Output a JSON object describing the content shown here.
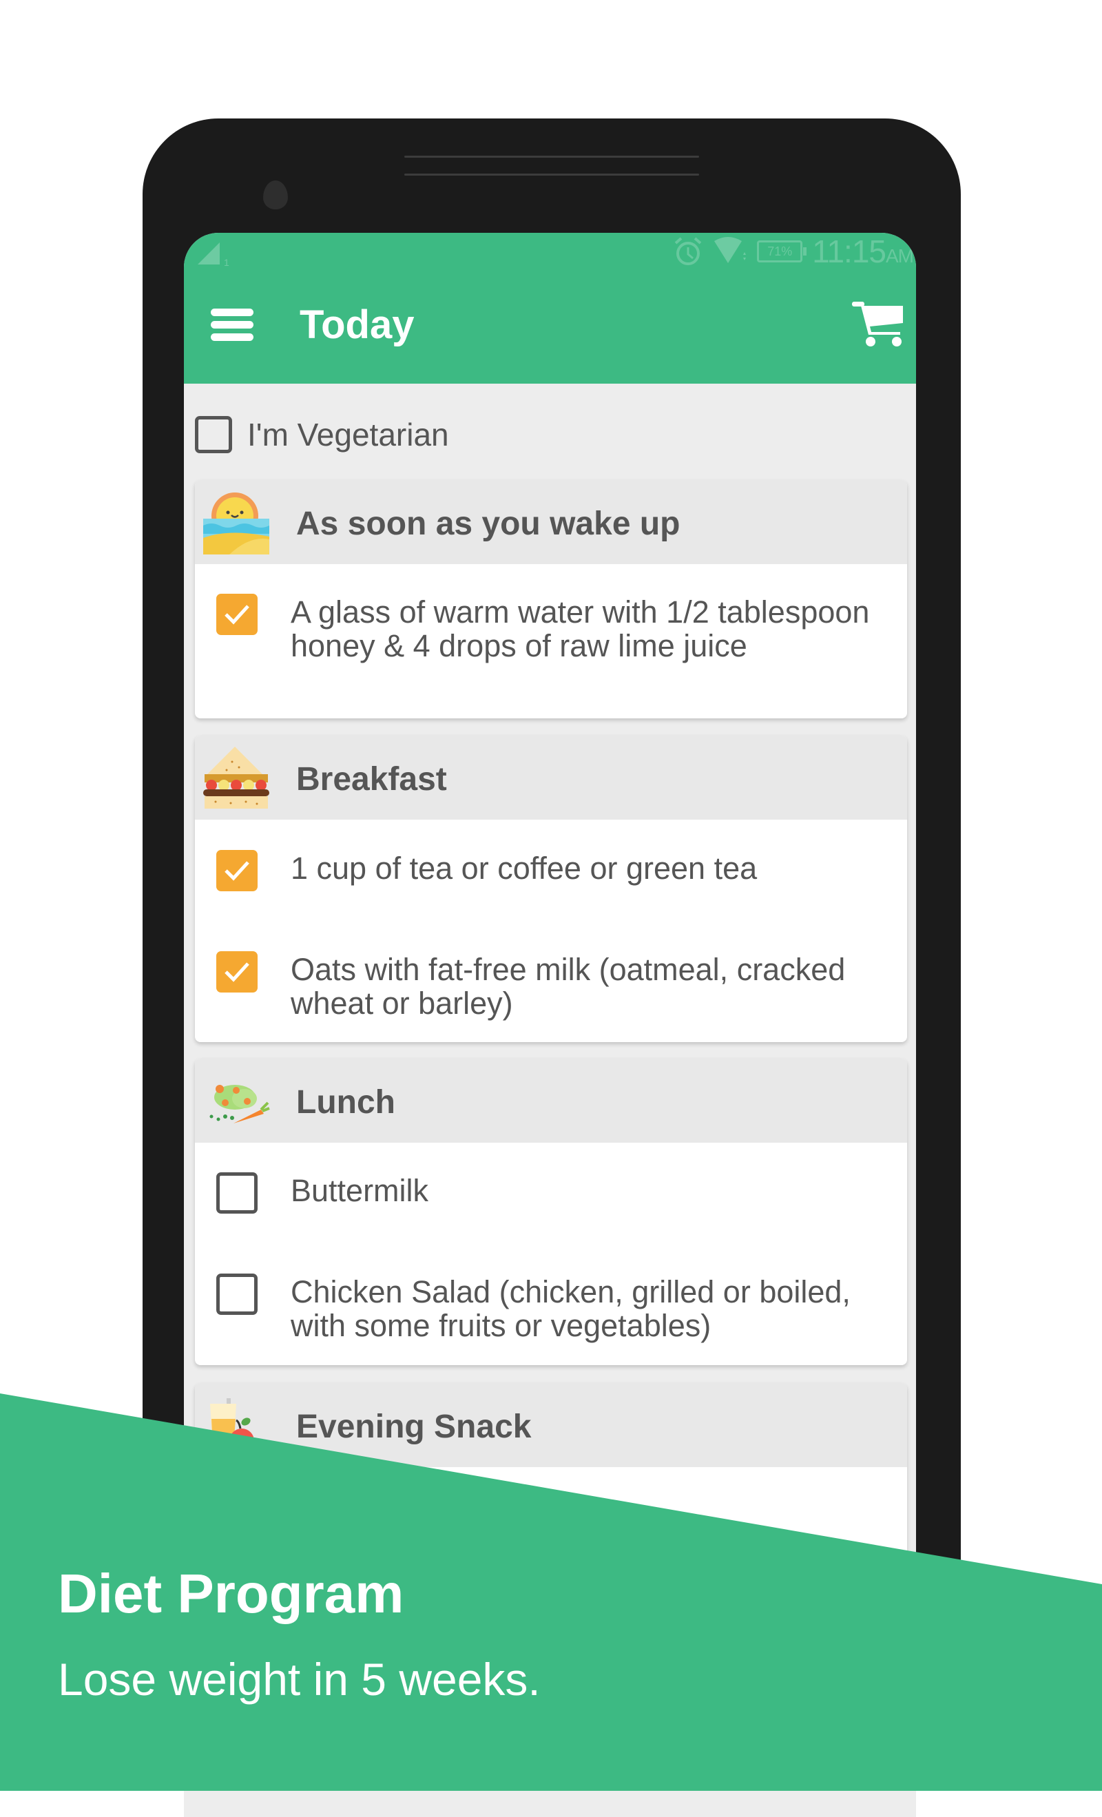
{
  "status_bar": {
    "signal_badge": "1",
    "battery": "71%",
    "time": "11:15",
    "ampm": "AM",
    "icons": [
      "signal-icon",
      "alarm-icon",
      "wifi-icon",
      "battery-icon"
    ]
  },
  "app_bar": {
    "title": "Today",
    "menu_icon": "hamburger-menu-icon",
    "cart_icon": "shopping-cart-icon"
  },
  "vegetarian": {
    "label": "I'm Vegetarian",
    "checked": false
  },
  "meals": [
    {
      "title": "As soon as you wake up",
      "icon": "sunrise-icon",
      "items": [
        {
          "text": "A glass of warm water with 1/2 tablespoon honey & 4 drops of raw lime juice",
          "checked": true
        }
      ]
    },
    {
      "title": "Breakfast",
      "icon": "sandwich-icon",
      "items": [
        {
          "text": "1 cup of tea or coffee or green tea",
          "checked": true
        },
        {
          "text": "Oats with fat-free milk (oatmeal, cracked wheat or barley)",
          "checked": true
        }
      ]
    },
    {
      "title": "Lunch",
      "icon": "salad-carrot-icon",
      "items": [
        {
          "text": "Buttermilk",
          "checked": false
        },
        {
          "text": "Chicken Salad (chicken, grilled or boiled, with some fruits or vegetables)",
          "checked": false
        }
      ]
    },
    {
      "title": "Evening Snack",
      "icon": "juice-apple-icon",
      "items": []
    }
  ],
  "promo": {
    "title": "Diet Program",
    "subtitle": "Lose weight in 5 weeks."
  },
  "colors": {
    "brand_green": "#3dba83",
    "check_orange": "#f5a831",
    "text_gray": "#555555",
    "header_gray": "#e8e8e8",
    "phone_black": "#1b1b1b"
  }
}
